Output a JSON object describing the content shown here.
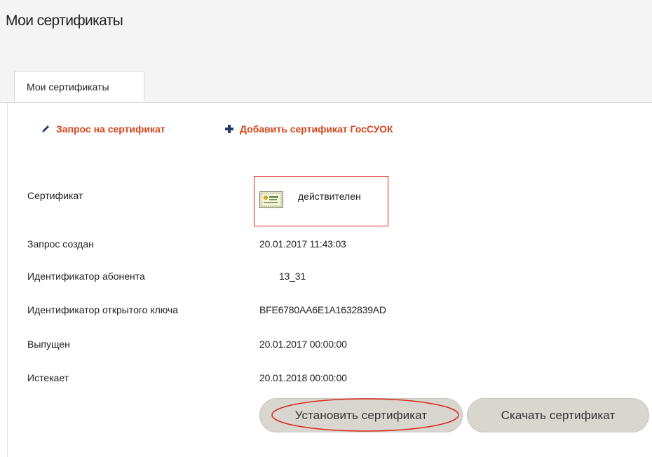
{
  "page": {
    "title": "Мои сертификаты"
  },
  "tabs": [
    {
      "label": "Мои сертификаты",
      "active": true
    }
  ],
  "actions": {
    "request": {
      "label": "Запрос на сертификат",
      "icon": "pencil-icon"
    },
    "add": {
      "label": "Добавить сертификат ГосСУОК",
      "icon": "plus-icon"
    }
  },
  "details": {
    "certificate": {
      "label": "Сертификат",
      "status": "действителен",
      "icon": "certificate-icon"
    },
    "rows": [
      {
        "label": "Запрос создан",
        "value": "20.01.2017 11:43:03"
      },
      {
        "label": "Идентификатор абонента",
        "value": "13_31"
      },
      {
        "label": "Идентификатор открытого ключа",
        "value": "BFE6780AA6E1A1632839AD"
      },
      {
        "label": "Выпущен",
        "value": "20.01.2017 00:00:00"
      },
      {
        "label": "Истекает",
        "value": "20.01.2018 00:00:00"
      }
    ]
  },
  "buttons": {
    "install": "Установить сертификат",
    "download": "Скачать сертификат"
  },
  "colors": {
    "accent_link": "#d6451b",
    "highlight": "#d9281e",
    "button_bg": "#d8d6cf",
    "header_bg": "#f4f4f4"
  }
}
